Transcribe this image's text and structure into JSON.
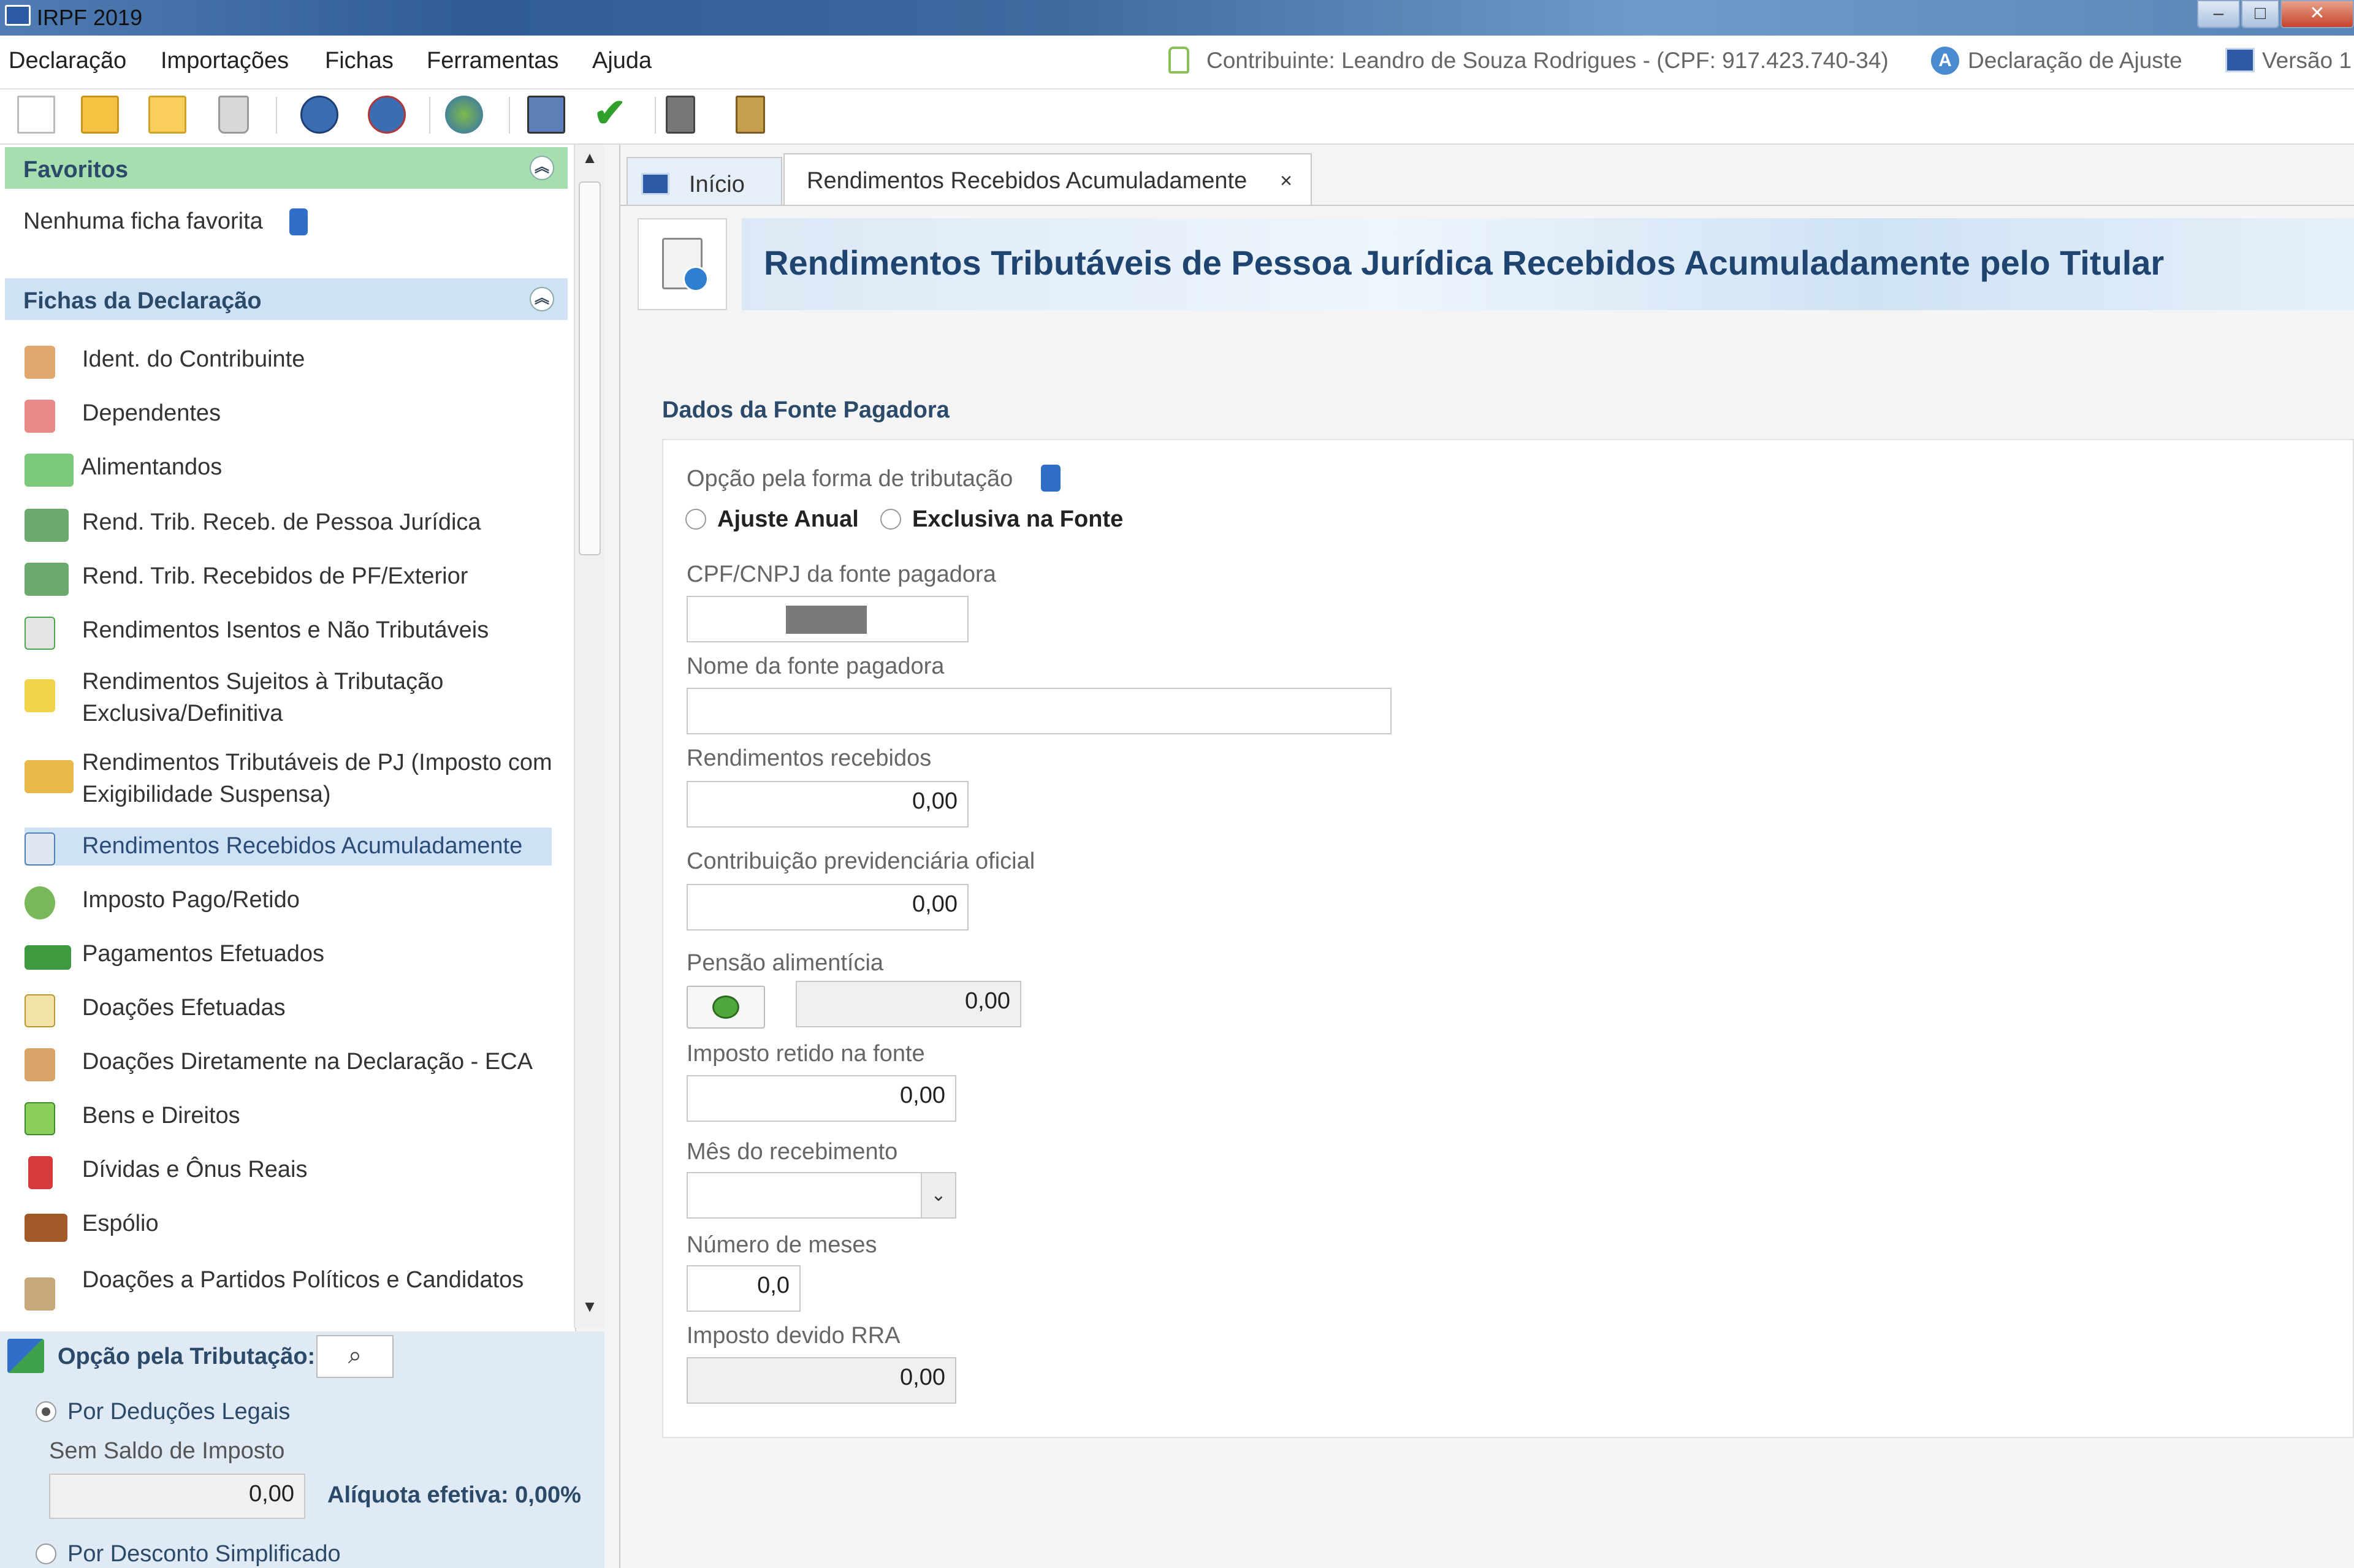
{
  "titlebar": {
    "title": "IRPF 2019"
  },
  "menubar": {
    "items": [
      "Declaração",
      "Importações",
      "Fichas",
      "Ferramentas",
      "Ajuda"
    ],
    "contribuinte": "Contribuinte: Leandro de Souza Rodrigues - (CPF: 917.423.740-34)",
    "declaracao": "Declaração de Ajuste",
    "versao": "Versão 1"
  },
  "left": {
    "favoritos_title": "Favoritos",
    "favoritos_empty": "Nenhuma ficha favorita",
    "fichas_title": "Fichas da Declaração",
    "items": [
      {
        "label": "Ident. do Contribuinte",
        "icon": "person-icon"
      },
      {
        "label": "Dependentes",
        "icon": "dependents-icon"
      },
      {
        "label": "Alimentandos",
        "icon": "alimentandos-icon"
      },
      {
        "label": "Rend. Trib. Receb. de Pessoa Jurídica",
        "icon": "income-pj-icon"
      },
      {
        "label": "Rend. Trib. Recebidos de PF/Exterior",
        "icon": "income-pf-icon"
      },
      {
        "label": "Rendimentos Isentos e Não Tributáveis",
        "icon": "exempt-income-icon"
      },
      {
        "label": "Rendimentos Sujeitos à Tributação Exclusiva/Definitiva",
        "icon": "exclusive-tax-icon"
      },
      {
        "label": "Rendimentos Tributáveis de PJ (Imposto com Exigibilidade Suspensa)",
        "icon": "suspended-tax-icon"
      },
      {
        "label": "Rendimentos Recebidos Acumuladamente",
        "icon": "accumulated-income-icon"
      },
      {
        "label": "Imposto Pago/Retido",
        "icon": "tax-paid-icon"
      },
      {
        "label": "Pagamentos Efetuados",
        "icon": "payments-icon"
      },
      {
        "label": "Doações Efetuadas",
        "icon": "donations-icon"
      },
      {
        "label": "Doações Diretamente na Declaração - ECA",
        "icon": "eca-donations-icon"
      },
      {
        "label": "Bens e Direitos",
        "icon": "assets-icon"
      },
      {
        "label": "Dívidas e Ônus Reais",
        "icon": "debts-icon"
      },
      {
        "label": "Espólio",
        "icon": "estate-icon"
      },
      {
        "label": "Doações a Partidos Políticos e Candidatos",
        "icon": "political-donations-icon"
      }
    ],
    "opcao_tributacao": "Opção pela Tributação:",
    "deducoes": "Por Deduções Legais",
    "sem_saldo": "Sem Saldo de Imposto",
    "valor": "0,00",
    "aliquota": "Alíquota efetiva: 0,00%",
    "simplificado": "Por Desconto Simplificado"
  },
  "right": {
    "tab_inicio": "Início",
    "tab_active": "Rendimentos Recebidos Acumuladamente",
    "tab_close": "×",
    "header_title": "Rendimentos Tributáveis de Pessoa Jurídica Recebidos Acumuladamente pelo Titular",
    "section_title": "Dados da Fonte Pagadora",
    "opcao_label": "Opção pela forma de tributação",
    "ajuste_anual": "Ajuste Anual",
    "exclusiva_fonte": "Exclusiva na Fonte",
    "cpf_label": "CPF/CNPJ da fonte pagadora",
    "nome_label": "Nome da fonte pagadora",
    "rendimentos_label": "Rendimentos recebidos",
    "rendimentos_value": "0,00",
    "contrib_label": "Contribuição previdenciária oficial",
    "contrib_value": "0,00",
    "pensao_label": "Pensão alimentícia",
    "pensao_value": "0,00",
    "imposto_label": "Imposto retido na fonte",
    "imposto_value": "0,00",
    "mes_label": "Mês do recebimento",
    "meses_label": "Número de meses",
    "meses_value": "0,0",
    "devido_label": "Imposto devido RRA",
    "devido_value": "0,00"
  }
}
